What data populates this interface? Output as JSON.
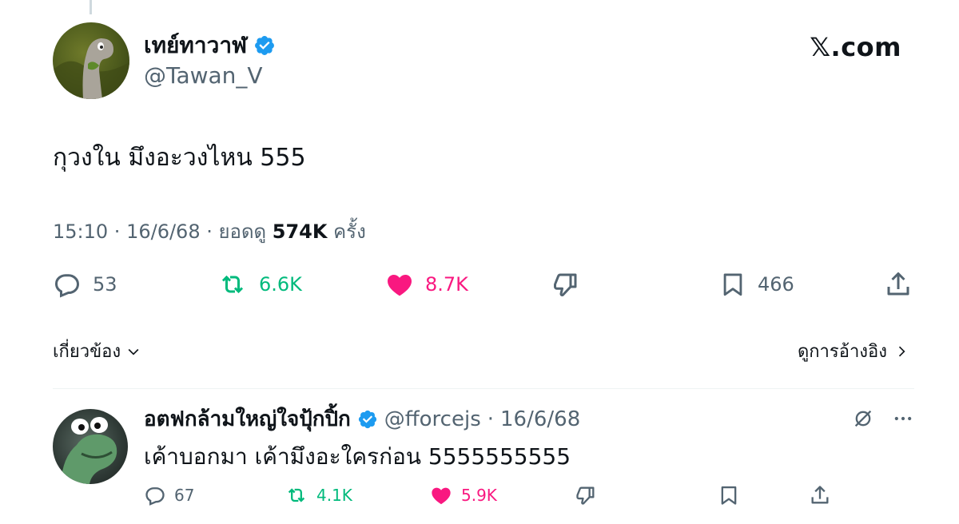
{
  "post": {
    "author": {
      "display_name": "เทย์ทาวาฬ",
      "handle": "@Tawan_V",
      "verified": true
    },
    "brand": "𝕏.com",
    "text": "กุวงใน มึงอะวงไหน 555",
    "meta": {
      "time": "15:10",
      "date": "16/6/68",
      "views_prefix": "ยอดดู",
      "views": "574K",
      "views_suffix": "ครั้ง"
    },
    "stats": {
      "replies": "53",
      "reposts": "6.6K",
      "likes": "8.7K",
      "bookmarks": "466"
    },
    "related_label": "เกี่ยวข้อง",
    "see_quotes_label": "ดูการอ้างอิง"
  },
  "reply": {
    "author": {
      "display_name": "อตฟกล้ามใหญ่ใจปุ้กปิ้ก",
      "handle": "@fforcejs",
      "date": "16/6/68",
      "verified": true
    },
    "text": "เค้าบอกมา เค้ามึงอะใครก่อน 5555555555",
    "stats": {
      "replies": "67",
      "reposts": "4.1K",
      "likes": "5.9K"
    }
  },
  "colors": {
    "verified": "#1d9bf0",
    "repost": "#00ba7c",
    "like": "#f91880",
    "muted": "#536471"
  }
}
